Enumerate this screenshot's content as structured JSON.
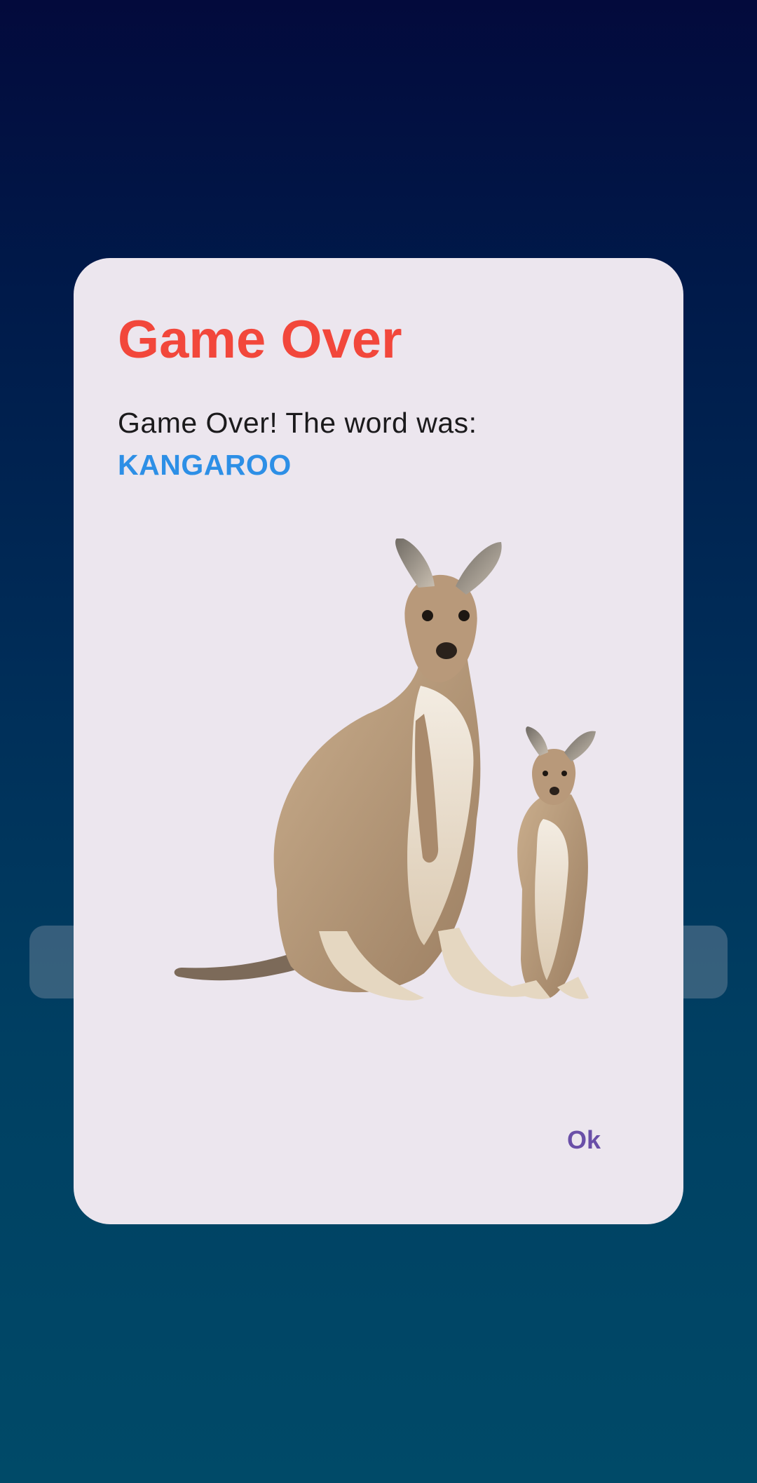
{
  "dialog": {
    "title": "Game Over",
    "message": "Game Over! The word was:",
    "word": "KANGAROO",
    "image_alt": "kangaroo-with-joey",
    "ok_label": "Ok"
  },
  "colors": {
    "title": "#f2473b",
    "word": "#2d8fe6",
    "button": "#6a4fa8",
    "dialog_bg": "#ece6ee"
  }
}
